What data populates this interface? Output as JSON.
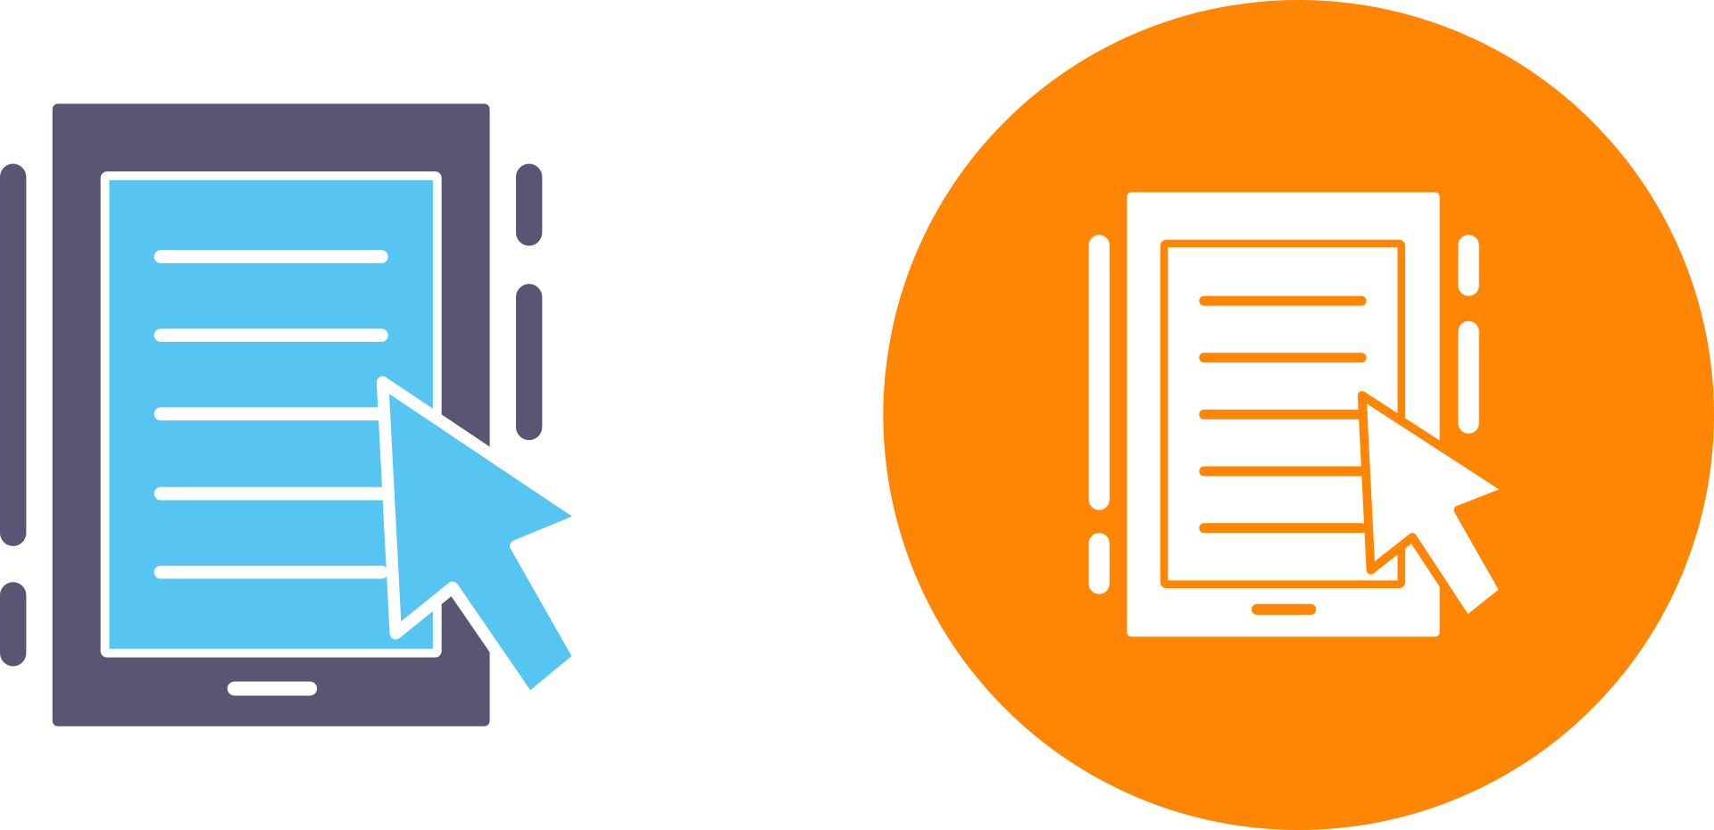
{
  "icons": {
    "glyph": {
      "name": "tablet-with-cursor-icon",
      "colors": {
        "body": "#595673",
        "screen": "#57C5F1",
        "line": "#ffffff",
        "cursor": "#57C5F1",
        "outline": "#ffffff"
      }
    },
    "circle": {
      "name": "tablet-with-cursor-circle-icon",
      "colors": {
        "background": "#FF8505",
        "body": "#ffffff",
        "screen": "#ffffff",
        "line": "#FF8505",
        "cursor": "#ffffff",
        "outline": "#FF8505"
      }
    }
  }
}
